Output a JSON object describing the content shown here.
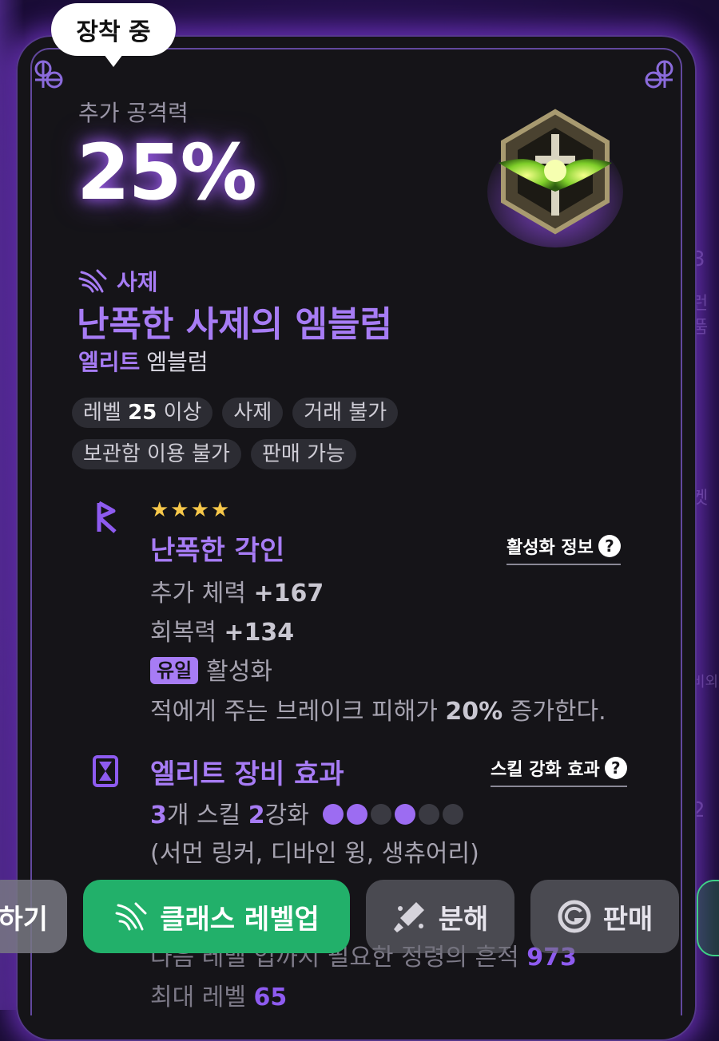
{
  "equip_badge": "장착 중",
  "stat": {
    "label": "추가 공격력",
    "value": "25%"
  },
  "item": {
    "class_name": "사제",
    "name": "난폭한 사제의 엠블럼",
    "grade": "엘리트",
    "kind": "엠블럼"
  },
  "tags": {
    "level_prefix": "레벨",
    "level_value": "25",
    "level_suffix": "이상",
    "class": "사제",
    "trade": "거래 불가",
    "storage": "보관함 이용 불가",
    "sell": "판매 가능"
  },
  "engraving": {
    "stars": "★★★★",
    "title": "난폭한 각인",
    "activation_link": "활성화 정보",
    "hp_label": "추가 체력",
    "hp_value": "+167",
    "regen_label": "회복력",
    "regen_value": "+134",
    "unique_badge": "유일",
    "activation_text": "활성화",
    "effect_pre": "적에게 주는 브레이크 피해가",
    "effect_num": "20%",
    "effect_post": "증가한다."
  },
  "elite_effect": {
    "title": "엘리트 장비 효과",
    "skill_link": "스킬 강화 효과",
    "count": "3",
    "count_suffix": "개 스킬",
    "enhance": "2",
    "enhance_suffix": "강화",
    "dots_filled": [
      true,
      true,
      false,
      true,
      false,
      false
    ],
    "skills": "(서먼 링커, 디바인 윙, 생츄어리)"
  },
  "bottom": {
    "next_level_text": "다음 레벨 업까지 필요한 정령의 흔적",
    "next_level_value": "973",
    "max_level_label": "최대 레벨",
    "max_level_value": "65"
  },
  "buttons": {
    "prev": "하기",
    "class_levelup": "클래스 레벨업",
    "dismantle": "분해",
    "sell": "판매"
  },
  "background_text": {
    "r1": "3",
    "r2": "런",
    "r3": "품",
    "r4": "켓",
    "r5": "비외",
    "r6": "2"
  },
  "colors": {
    "accent_purple": "#a77cf5",
    "card_bg": "#151418",
    "green_button": "#22b06a",
    "star_gold": "#f7c84a"
  },
  "icons": [
    "priest-wing-icon",
    "rune-icon",
    "elite-hourglass-icon",
    "help-icon",
    "dismantle-icon",
    "sell-coin-icon",
    "corner-knot-icon",
    "emblem-icon"
  ]
}
